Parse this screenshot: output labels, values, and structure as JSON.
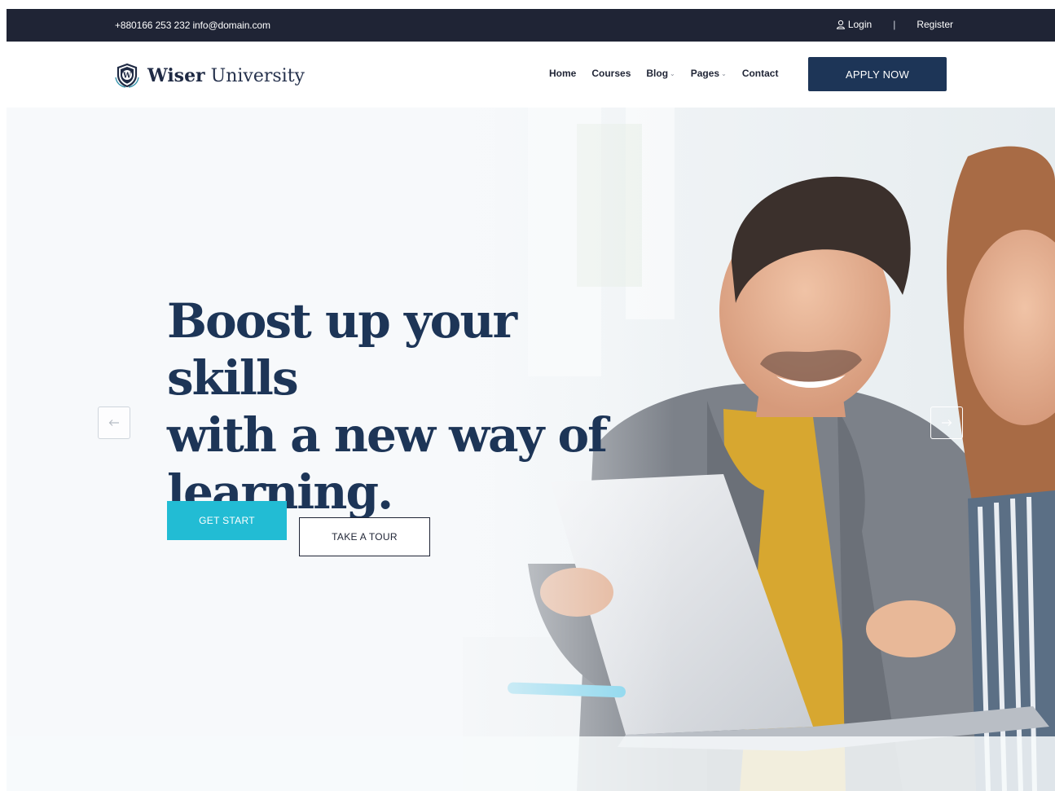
{
  "topbar": {
    "contact": "+880166 253 232 info@domain.com",
    "login_label": "Login",
    "separator": "|",
    "register_label": "Register"
  },
  "brand": {
    "name_bold": "Wiser",
    "name_light": "University",
    "logo_letter": "W"
  },
  "nav": {
    "items": [
      {
        "label": "Home",
        "has_dropdown": false
      },
      {
        "label": "Courses",
        "has_dropdown": false
      },
      {
        "label": "Blog",
        "has_dropdown": true
      },
      {
        "label": "Pages",
        "has_dropdown": true
      },
      {
        "label": "Contact",
        "has_dropdown": false
      }
    ],
    "apply_label": "APPLY NOW"
  },
  "hero": {
    "headline_line1": "Boost up your skills",
    "headline_line2": "with a new way of",
    "headline_line3": "learning.",
    "primary_button": "GET START",
    "secondary_button": "TAKE A TOUR",
    "prev_icon": "arrow-left-icon",
    "next_icon": "arrow-right-icon"
  },
  "colors": {
    "topbar_bg": "#1f2435",
    "navy": "#1d3557",
    "accent": "#22bcd4"
  }
}
